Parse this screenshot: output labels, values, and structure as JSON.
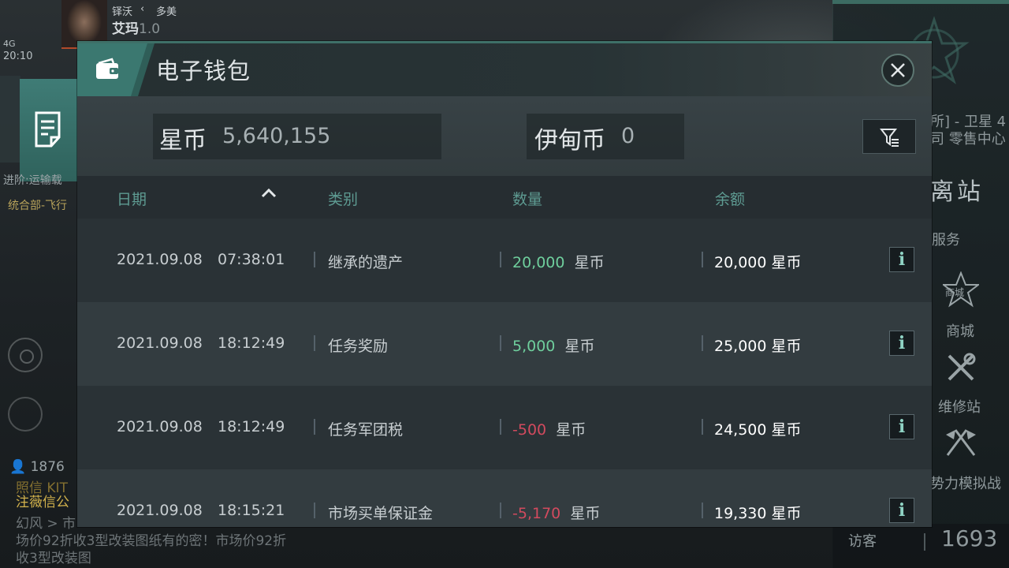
{
  "hud": {
    "player_name": "艾玛",
    "player_version": "1.0",
    "location_a": "铎沃",
    "location_b": "多美",
    "signal": "4G",
    "time": "20:10",
    "sidebar_line1": "进阶:运输载",
    "sidebar_line2": "统合部-飞行",
    "online_count": "1876",
    "chat_line1": "照信 KIT",
    "chat_line2": "注薇信公",
    "chat_line3": "幻风 > 市",
    "chat_line4": "场价92折收3型改装图纸有的密！市场价92折",
    "chat_line5": "收3型改装图"
  },
  "right_menu": {
    "station_line1": "所] - 卫星 4",
    "station_line2": "司 零售中心",
    "undock": "离站",
    "services": "服务",
    "shop_badge": "商城",
    "shop": "商城",
    "repair": "维修站",
    "sim": "势力模拟战",
    "visitors_label": "访客",
    "visitors_count": "1693"
  },
  "wallet": {
    "title": "电子钱包",
    "currencies": [
      {
        "label": "星币",
        "value": "5,640,155"
      },
      {
        "label": "伊甸币",
        "value": "0"
      }
    ],
    "columns": {
      "date": "日期",
      "category": "类别",
      "amount": "数量",
      "balance": "余额"
    },
    "unit": "星币",
    "rows": [
      {
        "date": "2021.09.08",
        "time": "07:38:01",
        "category": "继承的遗产",
        "amount": "20,000",
        "balance": "20,000 星币"
      },
      {
        "date": "2021.09.08",
        "time": "18:12:49",
        "category": "任务奖励",
        "amount": "5,000",
        "balance": "25,000 星币"
      },
      {
        "date": "2021.09.08",
        "time": "18:12:49",
        "category": "任务军团税",
        "amount": "-500",
        "balance": "24,500 星币"
      },
      {
        "date": "2021.09.08",
        "time": "18:15:21",
        "category": "市场买单保证金",
        "amount": "-5,170",
        "balance": "19,330 星币"
      }
    ],
    "info_label": "i",
    "colors": {
      "positive": "#6fcf9d",
      "negative": "#d24a5e",
      "accent": "#3b7870"
    }
  }
}
